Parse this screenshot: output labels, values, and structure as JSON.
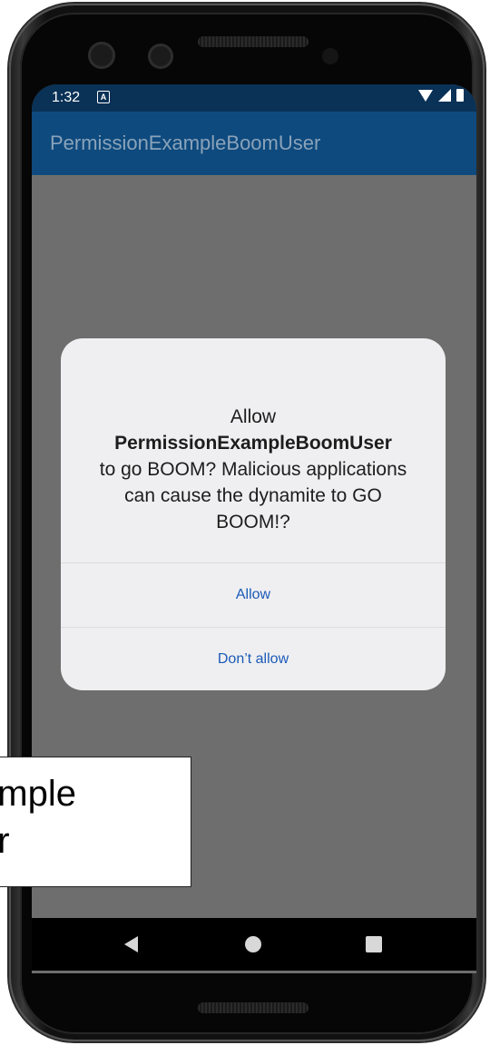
{
  "status_bar": {
    "time": "1:32",
    "notification_icon_letter": "A",
    "icons": [
      "wifi-icon",
      "cellular-signal-icon",
      "battery-icon"
    ],
    "background_color": "#0a3156"
  },
  "app_bar": {
    "title": "PermissionExampleBoomUser",
    "background_color": "#0e4a7e"
  },
  "dialog": {
    "line1": "Allow",
    "app_name": "PermissionExampleBoomUser",
    "line3": "to go BOOM? Malicious applications can cause the dynamite to GO BOOM!?",
    "allow_label": "Allow",
    "deny_label": "Don’t allow",
    "button_color": "#1a5ab8"
  },
  "overlay_label": {
    "text": "xample\nser"
  },
  "nav_bar": {
    "buttons": [
      "back-icon",
      "home-icon",
      "recents-icon"
    ]
  }
}
